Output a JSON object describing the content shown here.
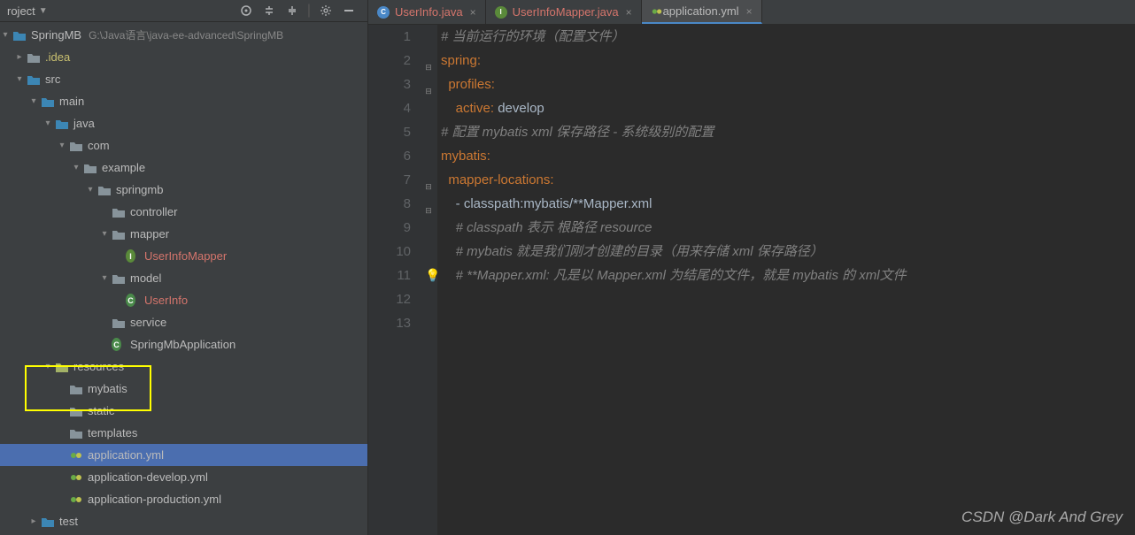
{
  "header": {
    "title": "roject",
    "path": "G:\\Java语言\\java-ee-advanced\\SpringMB",
    "root": "SpringMB"
  },
  "tree": [
    {
      "indent": 0,
      "arrow": "v",
      "icon": "folder-src",
      "label": "SpringMB",
      "pathShown": true
    },
    {
      "indent": 1,
      "arrow": ">",
      "icon": "folder",
      "label": ".idea",
      "cls": "yellow"
    },
    {
      "indent": 1,
      "arrow": "v",
      "icon": "folder-src",
      "label": "src"
    },
    {
      "indent": 2,
      "arrow": "v",
      "icon": "folder-src",
      "label": "main"
    },
    {
      "indent": 3,
      "arrow": "v",
      "icon": "folder-src",
      "label": "java"
    },
    {
      "indent": 4,
      "arrow": "v",
      "icon": "pkg",
      "label": "com"
    },
    {
      "indent": 5,
      "arrow": "v",
      "icon": "pkg",
      "label": "example"
    },
    {
      "indent": 6,
      "arrow": "v",
      "icon": "pkg",
      "label": "springmb"
    },
    {
      "indent": 7,
      "arrow": "",
      "icon": "pkg",
      "label": "controller"
    },
    {
      "indent": 7,
      "arrow": "v",
      "icon": "pkg",
      "label": "mapper"
    },
    {
      "indent": 8,
      "arrow": "",
      "icon": "class-i",
      "label": "UserInfoMapper",
      "cls": "red"
    },
    {
      "indent": 7,
      "arrow": "v",
      "icon": "pkg",
      "label": "model"
    },
    {
      "indent": 8,
      "arrow": "",
      "icon": "class-c",
      "label": "UserInfo",
      "cls": "red"
    },
    {
      "indent": 7,
      "arrow": "",
      "icon": "pkg",
      "label": "service"
    },
    {
      "indent": 7,
      "arrow": "",
      "icon": "class-c",
      "label": "SpringMbApplication"
    },
    {
      "indent": 3,
      "arrow": "v",
      "icon": "folder-res",
      "label": "resources"
    },
    {
      "indent": 4,
      "arrow": "",
      "icon": "folder",
      "label": "mybatis"
    },
    {
      "indent": 4,
      "arrow": "",
      "icon": "folder",
      "label": "static"
    },
    {
      "indent": 4,
      "arrow": "",
      "icon": "folder",
      "label": "templates"
    },
    {
      "indent": 4,
      "arrow": "",
      "icon": "yml",
      "label": "application.yml",
      "selected": true
    },
    {
      "indent": 4,
      "arrow": "",
      "icon": "yml",
      "label": "application-develop.yml"
    },
    {
      "indent": 4,
      "arrow": "",
      "icon": "yml",
      "label": "application-production.yml"
    },
    {
      "indent": 2,
      "arrow": ">",
      "icon": "folder-src",
      "label": "test"
    }
  ],
  "tabs": [
    {
      "icon": "c",
      "label": "UserInfo.java",
      "cls": "redt"
    },
    {
      "icon": "i",
      "label": "UserInfoMapper.java",
      "cls": "redt"
    },
    {
      "icon": "y",
      "label": "application.yml",
      "active": true
    }
  ],
  "code": [
    {
      "n": 1,
      "html": "<span class='comment'># 当前运行的环境（配置文件）</span>"
    },
    {
      "n": 2,
      "fold": "v",
      "html": "<span class='key'>spring</span><span class='colon'>:</span>"
    },
    {
      "n": 3,
      "fold": "v",
      "html": "  <span class='key'>profiles</span><span class='colon'>:</span>"
    },
    {
      "n": 4,
      "html": "    <span class='key'>active</span><span class='colon'>:</span> <span class='value'>develop</span>"
    },
    {
      "n": 5,
      "html": ""
    },
    {
      "n": 6,
      "html": "<span class='comment'># 配置 mybatis xml 保存路径 - 系统级别的配置</span>"
    },
    {
      "n": 7,
      "fold": "v",
      "html": "<span class='key'>mybatis</span><span class='colon'>:</span>"
    },
    {
      "n": 8,
      "fold": "v",
      "html": "  <span class='key'>mapper-locations</span><span class='colon'>:</span>"
    },
    {
      "n": 9,
      "html": "    - <span class='value'>classpath:mybatis/**Mapper.xml</span>"
    },
    {
      "n": 10,
      "html": "    <span class='comment'># classpath 表示 根路径 resource</span>"
    },
    {
      "n": 11,
      "html": "    <span class='comment'># mybatis 就是我们刚才创建的目录（用来存储 xml 保存路径）</span>"
    },
    {
      "n": 12,
      "bulb": true,
      "html": "    <span class='comment'># **Mapper.xml: 凡是以 Mapper.xml 为结尾的文件，就是 mybatis 的 xml文件</span>"
    },
    {
      "n": 13,
      "html": ""
    }
  ],
  "watermark": "CSDN @Dark And Grey"
}
